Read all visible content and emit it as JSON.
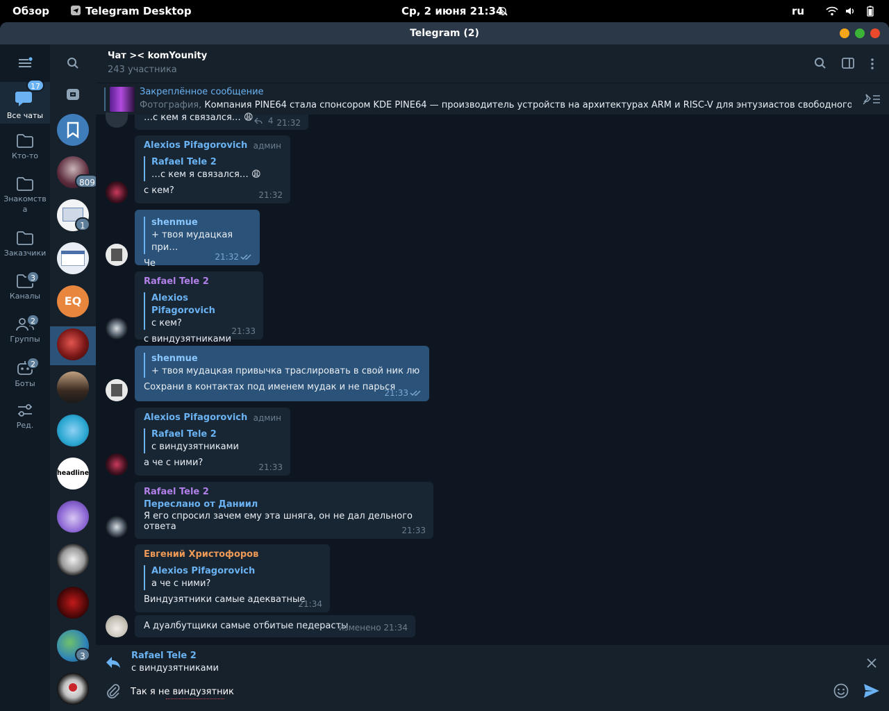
{
  "system": {
    "activities": "Обзор",
    "app": "Telegram Desktop",
    "datetime": "Ср, 2 июня  21:34",
    "lang": "ru"
  },
  "window": {
    "title": "Telegram (2)"
  },
  "folders": [
    {
      "label": "Все чаты",
      "badge": "17",
      "icon": "chats-icon"
    },
    {
      "label": "Кто-то",
      "badge": "",
      "icon": "folder-icon"
    },
    {
      "label": "Знакомства",
      "badge": "",
      "icon": "folder-icon"
    },
    {
      "label": "Заказчики",
      "badge": "",
      "icon": "folder-icon"
    },
    {
      "label": "Каналы",
      "badge": "3",
      "icon": "channel-folder-icon"
    },
    {
      "label": "Группы",
      "badge": "2",
      "icon": "groups-icon"
    },
    {
      "label": "Боты",
      "badge": "2",
      "icon": "bots-icon"
    },
    {
      "label": "Ред.",
      "badge": "",
      "icon": "edit-filters-icon"
    }
  ],
  "chatlist": {
    "badges": [
      "809",
      "1",
      "3"
    ],
    "eq_initials": "EQ",
    "headlines_text": "headlines"
  },
  "chat": {
    "title": "Чат >< komYounity",
    "subtitle": "243 участника"
  },
  "pinned": {
    "title": "Закреплённое сообщение",
    "prefix": "Фотография,",
    "text": "Компания PINE64 стала спонсором KDE  PINE64 — производитель устройств на архитектурах ARM и RISC-V для энтузиастов свободного программ…"
  },
  "messages": [
    {
      "text": "…с кем я связался… 😩",
      "replies": "4",
      "time": "21:32"
    },
    {
      "author": "Alexios Pifagorovich",
      "role": "админ",
      "quote_author": "Rafael Tele 2",
      "quote_text": "…с кем я связался… 😩",
      "text": "с кем?",
      "time": "21:32"
    },
    {
      "quote_author": "shenmue",
      "quote_text": "+ твоя мудацкая при…",
      "text": "Че",
      "time": "21:32"
    },
    {
      "author": "Rafael Tele 2",
      "quote_author": "Alexios Pifagorovich",
      "quote_text": "с кем?",
      "text": "с виндузятниками",
      "time": "21:33"
    },
    {
      "quote_author": "shenmue",
      "quote_text": "+ твоя мудацкая привычка траслировать в свой ник  любо…",
      "text": "Сохрани в контактах под именем мудак и не парься",
      "time": "21:33"
    },
    {
      "author": "Alexios Pifagorovich",
      "role": "админ",
      "quote_author": "Rafael Tele 2",
      "quote_text": "с виндузятниками",
      "text": "а че с ними?",
      "time": "21:33"
    },
    {
      "author": "Rafael Tele 2",
      "forwarded": "Переслано от Даниил",
      "text": "Я его спросил зачем ему эта шняга, он не дал дельного ответа",
      "time": "21:33"
    },
    {
      "author": "Евгений Христофоров",
      "quote_author": "Alexios Pifagorovich",
      "quote_text": "а че с ними?",
      "text": "Виндузятники самые адекватные",
      "time": "21:34"
    },
    {
      "text": "А дуалбутщики самые отбитые педерасты",
      "time": "изменено 21:34"
    }
  ],
  "compose": {
    "reply_author": "Rafael Tele 2",
    "reply_text": "с виндузятниками",
    "input_value": "Так я не виндузятник"
  },
  "colors": {
    "accent": "#6ab2f2",
    "name_purple": "#b180e8",
    "name_orange": "#ee9a57",
    "outgoing": "#2b5278",
    "incoming": "#182533"
  }
}
